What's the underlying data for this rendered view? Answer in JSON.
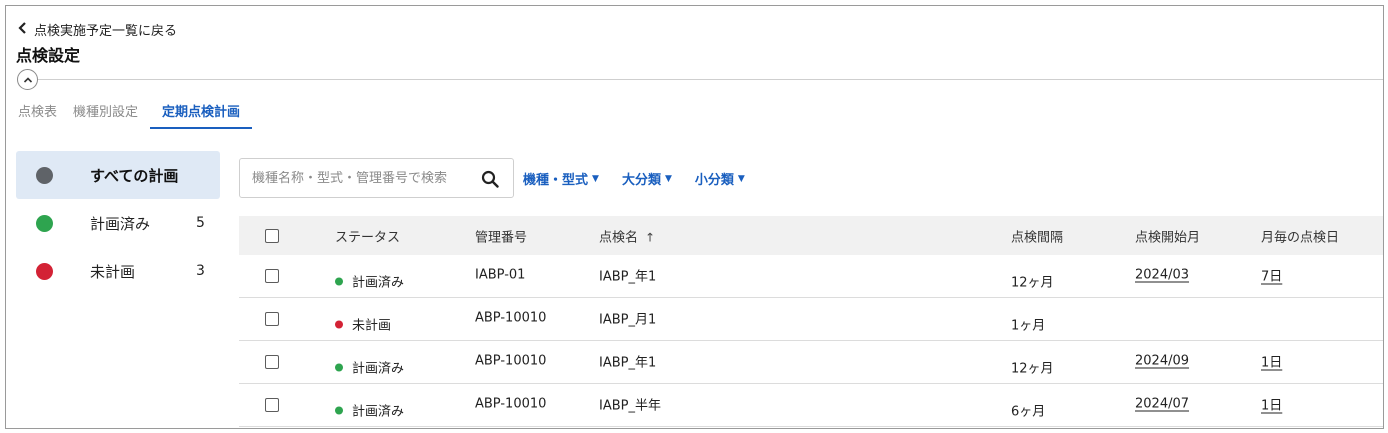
{
  "header": {
    "back_label": "点検実施予定一覧に戻る",
    "title": "点検設定"
  },
  "tabs": [
    "点検表",
    "機種別設定",
    "定期点検計画"
  ],
  "active_tab": "定期点検計画",
  "sidebar": {
    "items": [
      {
        "label": "すべての計画",
        "count": "",
        "color": "#5f6368",
        "active": true
      },
      {
        "label": "計画済み",
        "count": "5",
        "color": "#2ea44f",
        "active": false
      },
      {
        "label": "未計画",
        "count": "3",
        "color": "#d32235",
        "active": false
      }
    ]
  },
  "search": {
    "placeholder": "機種名称・型式・管理番号で検索",
    "value": "",
    "icon": "search-icon"
  },
  "filters": [
    {
      "label": "機種・型式",
      "icon": "caret-down-icon"
    },
    {
      "label": "大分類",
      "icon": "caret-down-icon"
    },
    {
      "label": "小分類",
      "icon": "caret-down-icon"
    }
  ],
  "table": {
    "headers": {
      "status": "ステータス",
      "id": "管理番号",
      "name": "点検名",
      "name_sort": "↑",
      "interval": "点検間隔",
      "start": "点検開始月",
      "day": "月毎の点検日"
    },
    "rows": [
      {
        "status": "計画済み",
        "status_color": "#2ea44f",
        "id": "IABP-01",
        "name": "IABP_年1",
        "interval": "12ヶ月",
        "start": "2024/03",
        "day": "7日"
      },
      {
        "status": "未計画",
        "status_color": "#d32235",
        "id": "ABP-10010",
        "name": "IABP_月1",
        "interval": "1ヶ月",
        "start": "",
        "day": ""
      },
      {
        "status": "計画済み",
        "status_color": "#2ea44f",
        "id": "ABP-10010",
        "name": "IABP_年1",
        "interval": "12ヶ月",
        "start": "2024/09",
        "day": "1日"
      },
      {
        "status": "計画済み",
        "status_color": "#2ea44f",
        "id": "ABP-10010",
        "name": "IABP_半年",
        "interval": "6ヶ月",
        "start": "2024/07",
        "day": "1日"
      }
    ]
  },
  "colors": {
    "accent": "#1a5fbf",
    "planned": "#2ea44f",
    "unplanned": "#d32235",
    "all": "#5f6368"
  }
}
